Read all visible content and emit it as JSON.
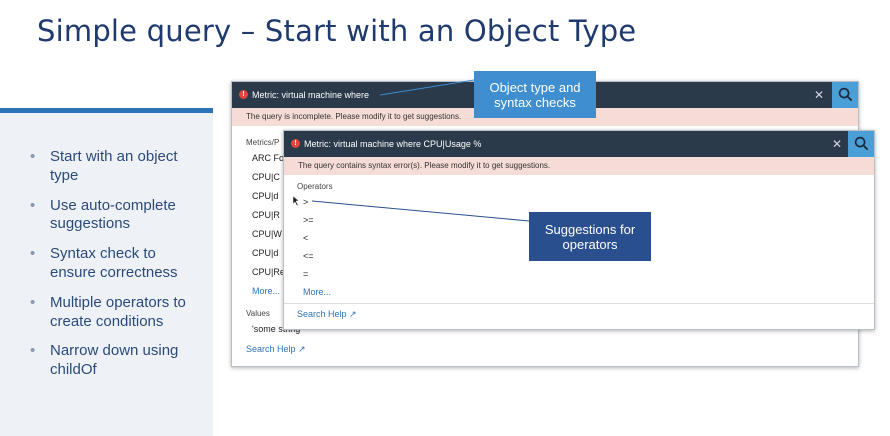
{
  "slide": {
    "title": "Simple query – Start with an Object Type",
    "bullets": [
      "Start with an object type",
      "Use auto-complete suggestions",
      "Syntax check to ensure correctness",
      "Multiple operators to create conditions",
      "Narrow down using childOf"
    ]
  },
  "back_window": {
    "query": "Metric: virtual machine where",
    "warning": "The query is incomplete. Please modify it to get suggestions.",
    "section_metrics": "Metrics/P",
    "items": [
      "ARC Fo",
      "CPU|C",
      "CPU|d",
      "CPU|R",
      "CPU|W",
      "CPU|d",
      "CPU|Re"
    ],
    "more": "More...",
    "section_values": "Values",
    "value": "'some string'",
    "search_help": "Search Help"
  },
  "front_window": {
    "query": "Metric: virtual machine where CPU|Usage %",
    "warning": "The query contains syntax error(s). Please modify it to get suggestions.",
    "section_operators": "Operators",
    "operators": [
      ">",
      ">=",
      "<",
      "<=",
      "="
    ],
    "more": "More...",
    "search_help": "Search Help"
  },
  "callouts": {
    "object_type": "Object type and syntax checks",
    "operators": "Suggestions for operators"
  },
  "icons": {
    "close": "close-icon",
    "search": "search-icon",
    "error": "error-icon",
    "external": "external-link-icon"
  },
  "colors": {
    "title": "#1e3a6e",
    "bar": "#2b3a4a",
    "accent": "#4a9fd6",
    "warning_bg": "#f6dcd6",
    "callout1": "#3e8ed0",
    "callout2": "#2a4f8f"
  }
}
